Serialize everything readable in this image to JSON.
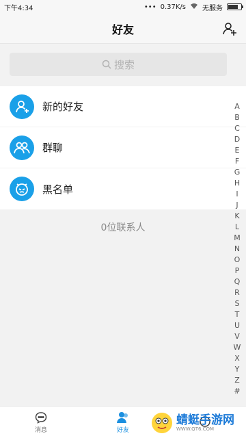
{
  "status_bar": {
    "time": "下午4:34",
    "network_speed": "0.37K/s",
    "carrier": "无服务"
  },
  "header": {
    "title": "好友",
    "add_icon": "add-friend-icon"
  },
  "search": {
    "placeholder": "搜索"
  },
  "list": [
    {
      "label": "新的好友",
      "icon": "new-friend-icon"
    },
    {
      "label": "群聊",
      "icon": "group-chat-icon"
    },
    {
      "label": "黑名单",
      "icon": "blacklist-icon"
    }
  ],
  "contact_count": "0位联系人",
  "index_letters": [
    "A",
    "B",
    "C",
    "D",
    "E",
    "F",
    "G",
    "H",
    "I",
    "J",
    "K",
    "L",
    "M",
    "N",
    "O",
    "P",
    "Q",
    "R",
    "S",
    "T",
    "U",
    "V",
    "W",
    "X",
    "Y",
    "Z",
    "#"
  ],
  "tabs": [
    {
      "label": "消息",
      "icon": "message-icon",
      "active": false
    },
    {
      "label": "好友",
      "icon": "friends-icon",
      "active": true
    },
    {
      "label": "",
      "icon": "discover-icon",
      "active": false
    }
  ],
  "watermark": {
    "text": "蜻蜓手游网",
    "url": "WWW.QT6.COM"
  },
  "colors": {
    "accent": "#1a8fe0",
    "avatar_bg": "#1aa0e8",
    "background": "#f2f2f2"
  }
}
